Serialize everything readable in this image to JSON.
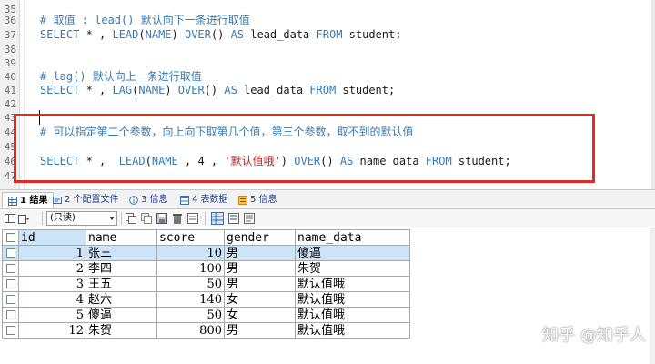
{
  "editor": {
    "lines": [
      {
        "num": "35",
        "text": "",
        "kind": "blank"
      },
      {
        "num": "36",
        "text": "# 取值 : lead() 默认向下一条进行取值",
        "kind": "comment"
      },
      {
        "num": "37",
        "kind": "sql",
        "parts": [
          "SELECT",
          " * , ",
          "LEAD",
          "(",
          "NAME",
          ") ",
          "OVER",
          "() ",
          "AS",
          " lead_data ",
          "FROM",
          " student;"
        ]
      },
      {
        "num": "38",
        "text": "",
        "kind": "blank"
      },
      {
        "num": "39",
        "text": "",
        "kind": "blank"
      },
      {
        "num": "40",
        "text": "# lag() 默认向上一条进行取值",
        "kind": "comment"
      },
      {
        "num": "41",
        "kind": "sql",
        "parts": [
          "SELECT",
          " * , ",
          "LAG",
          "(",
          "NAME",
          ") ",
          "OVER",
          "() ",
          "AS",
          " lead_data ",
          "FROM",
          " student;"
        ]
      },
      {
        "num": "42",
        "text": "",
        "kind": "blank"
      },
      {
        "num": "43",
        "text": "",
        "kind": "blank"
      },
      {
        "num": "44",
        "text": "# 可以指定第二个参数，向上向下取第几个值，第三个参数，取不到的默认值",
        "kind": "comment"
      },
      {
        "num": "45",
        "text": "",
        "kind": "blank"
      },
      {
        "num": "46",
        "kind": "sql",
        "parts": [
          "SELECT",
          " * ,  ",
          "LEAD",
          "(",
          "NAME",
          " , 4 , ",
          "'默认值哦'",
          ") ",
          "OVER",
          "() ",
          "AS",
          " name_data ",
          "FROM",
          " student;"
        ]
      },
      {
        "num": "47",
        "text": "",
        "kind": "blank"
      }
    ]
  },
  "tabs": [
    {
      "label": "1 结果",
      "icon": "grid-icon",
      "active": true
    },
    {
      "label": "2 个配置文件",
      "icon": "profile-icon",
      "active": false
    },
    {
      "label": "3 信息",
      "icon": "info-icon",
      "active": false
    },
    {
      "label": "4 表数据",
      "icon": "table-icon",
      "active": false
    },
    {
      "label": "5 信息",
      "icon": "info2-icon",
      "active": false
    }
  ],
  "toolbar": {
    "mode_value": "(只读)",
    "icons": [
      "export-icon",
      "dropdown-icon",
      "copy-icon",
      "paste-icon",
      "save-icon",
      "delete-icon",
      "refresh-icon",
      "grid-view-icon",
      "form-view-icon",
      "text-view-icon"
    ]
  },
  "results": {
    "columns": [
      "id",
      "name",
      "score",
      "gender",
      "name_data"
    ],
    "rows": [
      [
        "1",
        "张三",
        "10",
        "男",
        "傻逼"
      ],
      [
        "2",
        "李四",
        "100",
        "男",
        "朱贺"
      ],
      [
        "3",
        "王五",
        "50",
        "男",
        "默认值哦"
      ],
      [
        "4",
        "赵六",
        "140",
        "女",
        "默认值哦"
      ],
      [
        "5",
        "傻逼",
        "50",
        "女",
        "默认值哦"
      ],
      [
        "12",
        "朱贺",
        "800",
        "男",
        "默认值哦"
      ]
    ],
    "selected_row": 0
  },
  "watermark": "知乎 @知乎人",
  "colors": {
    "highlight_border": "#e02a25",
    "keyword": "#3a7ab0",
    "string": "#b3262d",
    "selected_row": "#cde3f7"
  }
}
